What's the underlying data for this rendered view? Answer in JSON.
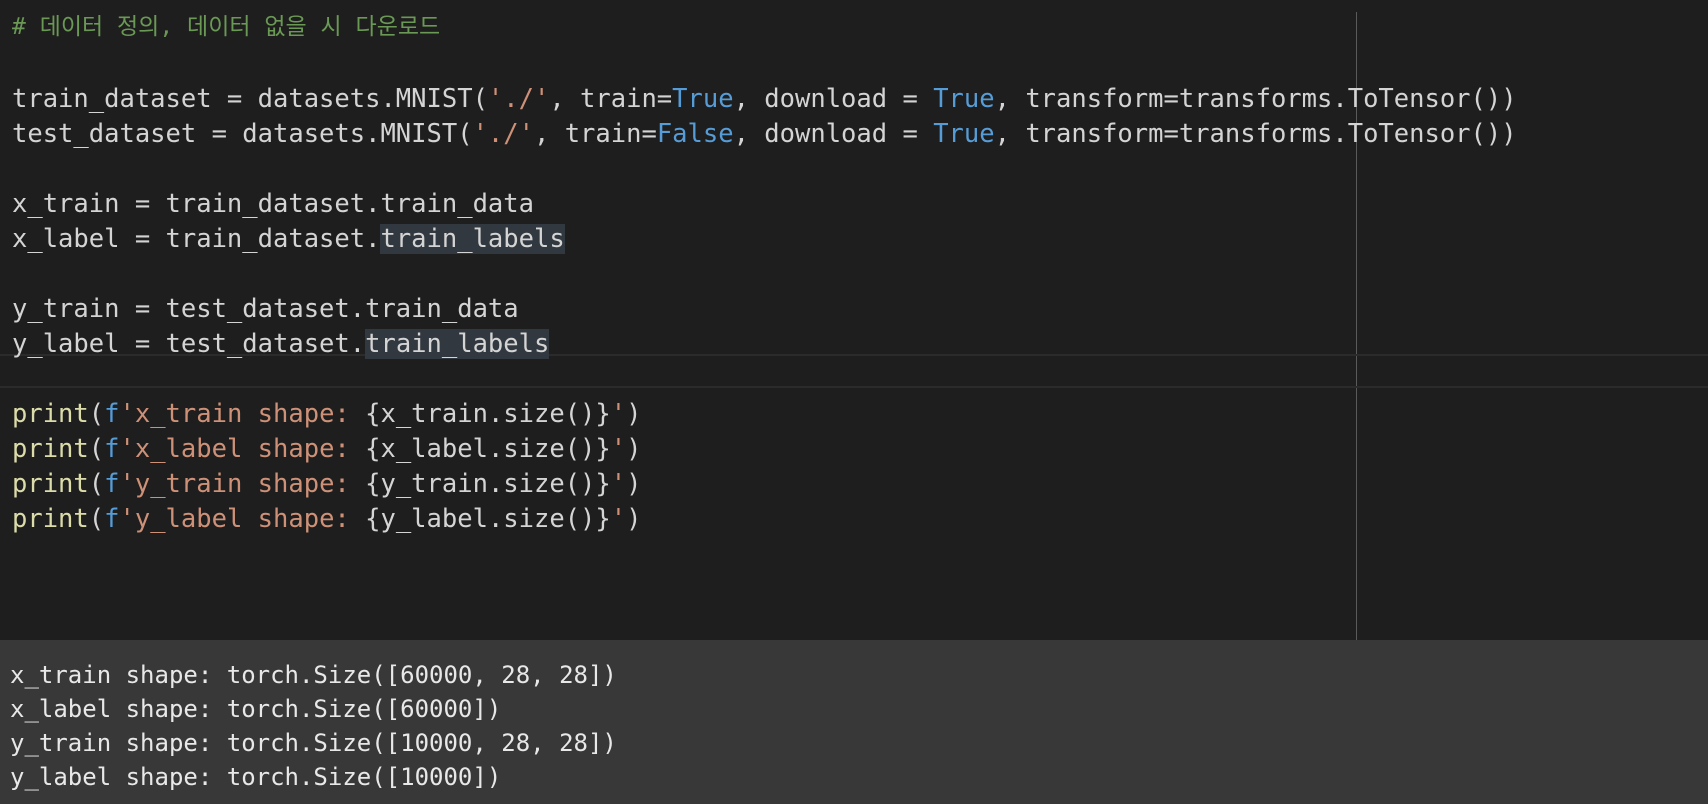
{
  "editor": {
    "comment": "# 데이터 정의, 데이터 없을 시 다운로드",
    "line1": {
      "a": "train_dataset = datasets.MNIST(",
      "s": "'./'",
      "b": ", train=",
      "k1": "True",
      "c": ", download = ",
      "k2": "True",
      "d": ", transform=transforms.ToTensor())"
    },
    "line2": {
      "a": "test_dataset = datasets.MNIST(",
      "s": "'./'",
      "b": ", train=",
      "k1": "False",
      "c": ", download = ",
      "k2": "True",
      "d": ", transform=transforms.ToTensor())"
    },
    "line3": "x_train = train_dataset.train_data",
    "line4": {
      "a": "x_label = train_dataset.",
      "hl": "train_labels"
    },
    "line5": "y_train = test_dataset.train_data",
    "line6": {
      "a": "y_label = test_dataset.",
      "hl": "train_labels"
    },
    "prints": [
      {
        "fn": "print",
        "p1": "(",
        "f": "f",
        "s1": "'x_train shape: ",
        "expr": "{x_train.size()}",
        "s2": "'",
        "p2": ")"
      },
      {
        "fn": "print",
        "p1": "(",
        "f": "f",
        "s1": "'x_label shape: ",
        "expr": "{x_label.size()}",
        "s2": "'",
        "p2": ")"
      },
      {
        "fn": "print",
        "p1": "(",
        "f": "f",
        "s1": "'y_train shape: ",
        "expr": "{y_train.size()}",
        "s2": "'",
        "p2": ")"
      },
      {
        "fn": "print",
        "p1": "(",
        "f": "f",
        "s1": "'y_label shape: ",
        "expr": "{y_label.size()}",
        "s2": "'",
        "p2": ")"
      }
    ]
  },
  "output": {
    "lines": [
      "x_train shape: torch.Size([60000, 28, 28])",
      "x_label shape: torch.Size([60000])",
      "y_train shape: torch.Size([10000, 28, 28])",
      "y_label shape: torch.Size([10000])"
    ]
  },
  "colors": {
    "editor_bg": "#1e1e1e",
    "output_bg": "#383838",
    "comment": "#6a9955",
    "keyword": "#569cd6",
    "string": "#ce9178",
    "function": "#dcdcaa"
  }
}
